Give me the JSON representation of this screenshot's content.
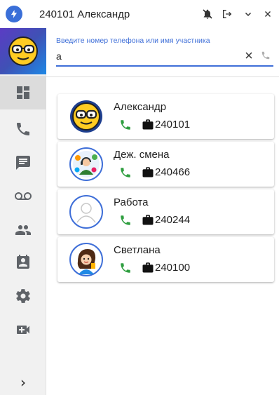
{
  "window": {
    "title": "240101 Александр",
    "buttons": [
      "mute-notifications",
      "logout",
      "minimize",
      "close"
    ]
  },
  "sidebar": {
    "user_avatar": "emoji-glasses",
    "items": [
      {
        "name": "dashboard",
        "icon": "dashboard-icon",
        "active": true
      },
      {
        "name": "calls",
        "icon": "phone-icon",
        "active": false
      },
      {
        "name": "chat",
        "icon": "chat-icon",
        "active": false
      },
      {
        "name": "voicemail",
        "icon": "voicemail-icon",
        "active": false
      },
      {
        "name": "contacts",
        "icon": "people-icon",
        "active": false
      },
      {
        "name": "directory",
        "icon": "contact-card-icon",
        "active": false
      },
      {
        "name": "settings",
        "icon": "gear-icon",
        "active": false
      },
      {
        "name": "video",
        "icon": "video-add-icon",
        "active": false
      }
    ],
    "expand": "›"
  },
  "search": {
    "label": "Введите номер телефона или имя участника",
    "value": "а"
  },
  "contacts": [
    {
      "name": "Александр",
      "number": "240101",
      "avatar": "emoji-glasses"
    },
    {
      "name": "Деж. смена",
      "number": "240466",
      "avatar": "operator"
    },
    {
      "name": "Работа",
      "number": "240244",
      "avatar": "placeholder"
    },
    {
      "name": "Светлана",
      "number": "240100",
      "avatar": "woman-cartoon"
    }
  ],
  "colors": {
    "accent": "#3f6fd8",
    "phone_green": "#2e9e3f",
    "sidebar_icon": "#5f6368"
  }
}
